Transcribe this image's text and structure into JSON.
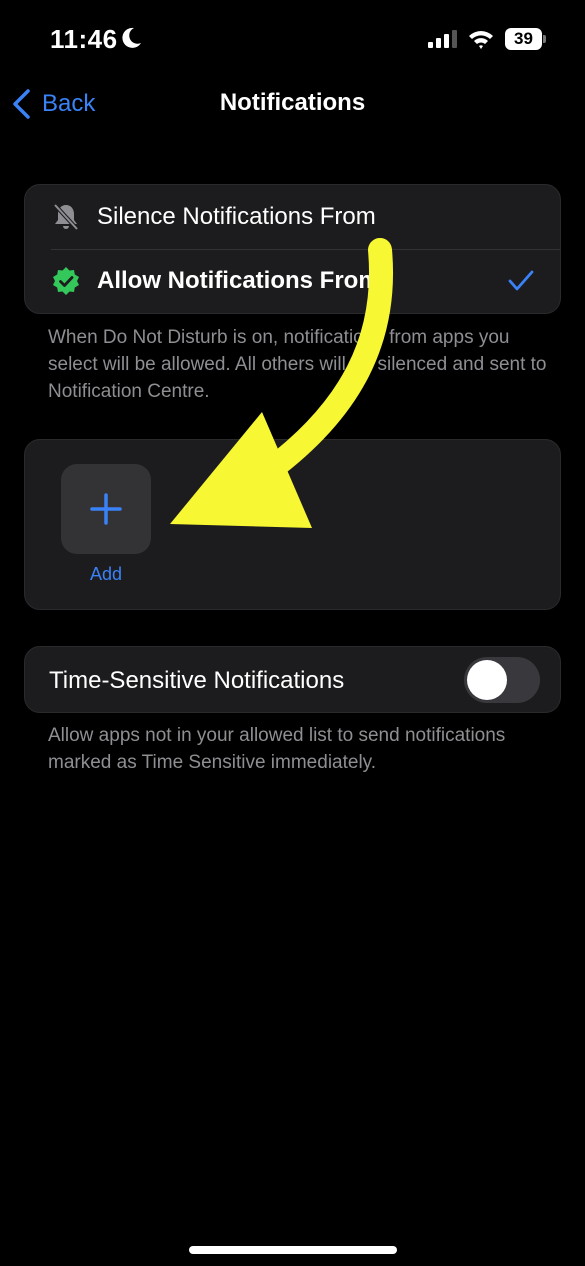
{
  "status_bar": {
    "time": "11:46",
    "battery": "39"
  },
  "nav": {
    "back_label": "Back",
    "title": "Notifications"
  },
  "mode_group": {
    "silence_label": "Silence Notifications From",
    "allow_label": "Allow Notifications From",
    "allow_selected": true
  },
  "mode_footnote": "When Do Not Disturb is on, notifications from apps you select will be allowed. All others will be silenced and sent to Notification Centre.",
  "apps_group": {
    "add_label": "Add"
  },
  "time_sensitive": {
    "label": "Time-Sensitive Notifications",
    "enabled": false,
    "footnote": "Allow apps not in your allowed list to send notifications marked as Time Sensitive immediately."
  },
  "colors": {
    "background": "#000000",
    "group": "#1c1c1e",
    "accent": "#3a82f7",
    "secondary_text": "#8e8e93",
    "allow_badge": "#34c759",
    "annotation_arrow": "#f7f734"
  },
  "icons": [
    "moon-icon",
    "cellular-signal-icon",
    "wifi-icon",
    "battery-icon",
    "chevron-left-icon",
    "bell-slash-icon",
    "verified-check-badge-icon",
    "checkmark-icon",
    "plus-icon"
  ]
}
